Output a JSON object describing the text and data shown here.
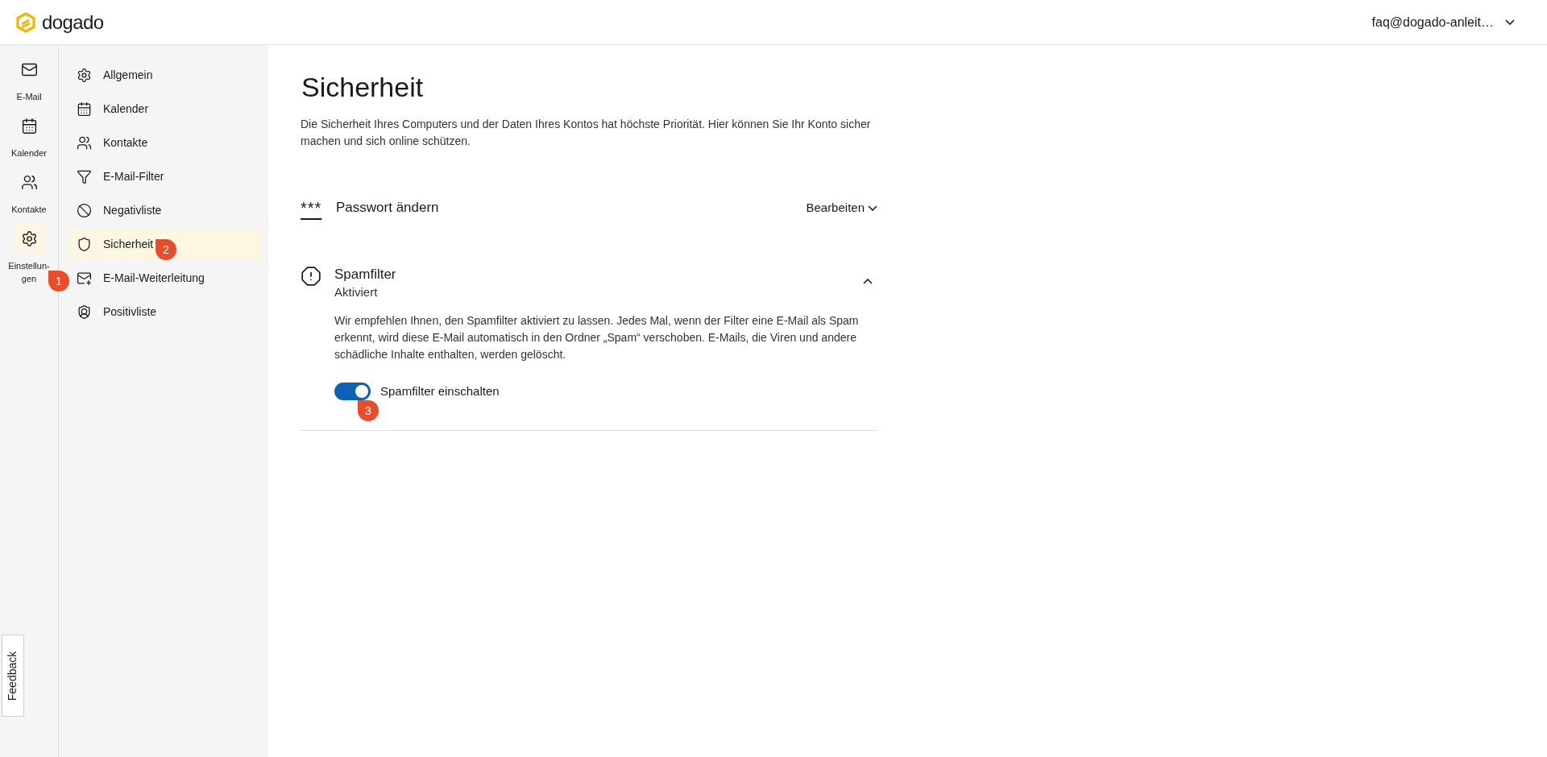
{
  "header": {
    "logo": "dogado",
    "account": "faq@dogado-anleit…"
  },
  "rail": [
    {
      "label": "E-Mail",
      "selected": false
    },
    {
      "label": "Kalender",
      "selected": false
    },
    {
      "label": "Kontakte",
      "selected": false
    },
    {
      "label": "Einstellun-\ngen",
      "selected": true
    }
  ],
  "settings_nav": [
    {
      "label": "Allgemein",
      "selected": false
    },
    {
      "label": "Kalender",
      "selected": false
    },
    {
      "label": "Kontakte",
      "selected": false
    },
    {
      "label": "E-Mail-Filter",
      "selected": false
    },
    {
      "label": "Negativliste",
      "selected": false
    },
    {
      "label": "Sicherheit",
      "selected": true
    },
    {
      "label": "E-Mail-Weiterleitung",
      "selected": false
    },
    {
      "label": "Positivliste",
      "selected": false
    }
  ],
  "page": {
    "title": "Sicherheit",
    "description": "Die Sicherheit Ihres Computers und der Daten Ihres Kontos hat höchste Priorität. Hier können Sie Ihr Konto sicher machen und sich online schützen."
  },
  "password": {
    "icon_text": "***",
    "title": "Passwort ändern",
    "action": "Bearbeiten",
    "expanded": false
  },
  "spamfilter": {
    "title": "Spamfilter",
    "status": "Aktiviert",
    "expanded": true,
    "text": "Wir empfehlen Ihnen, den Spamfilter aktiviert zu lassen. Jedes Mal, wenn der Filter eine E-Mail als Spam erkennt, wird diese E-Mail automatisch in den Ordner „Spam“ verschoben. E-Mails, die Viren und andere schädliche Inhalte enthalten, werden gelöscht.",
    "toggle": {
      "label": "Spamfilter einschalten",
      "on": true
    }
  },
  "feedback": "Feedback",
  "callouts": [
    "1",
    "2",
    "3"
  ]
}
